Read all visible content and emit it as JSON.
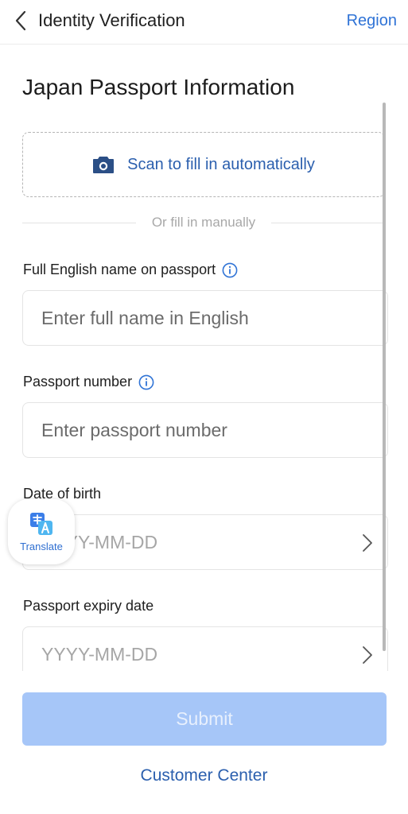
{
  "header": {
    "back_icon": "chevron-left-icon",
    "title": "Identity Verification",
    "region_link": "Region"
  },
  "main": {
    "title": "Japan Passport Information",
    "scan": {
      "icon": "camera-icon",
      "label": "Scan to fill in automatically"
    },
    "divider_text": "Or fill in manually",
    "fields": {
      "full_name": {
        "label": "Full English name on passport",
        "placeholder": "Enter full name in English",
        "info_icon": "info-icon"
      },
      "passport_number": {
        "label": "Passport number",
        "placeholder": "Enter passport number",
        "info_icon": "info-icon"
      },
      "date_of_birth": {
        "label": "Date of birth",
        "placeholder": "YYYY-MM-DD",
        "chevron_icon": "chevron-right-icon"
      },
      "expiry_date": {
        "label": "Passport expiry date",
        "placeholder": "YYYY-MM-DD",
        "chevron_icon": "chevron-right-icon"
      }
    }
  },
  "translate_fab": {
    "icon": "translate-icon",
    "label": "Translate"
  },
  "footer": {
    "submit_label": "Submit",
    "customer_center": "Customer Center"
  },
  "colors": {
    "accent": "#2f73d6",
    "link_dark": "#2b5fae",
    "submit_disabled": "#a6c6f8",
    "border": "#e4e4e4"
  }
}
